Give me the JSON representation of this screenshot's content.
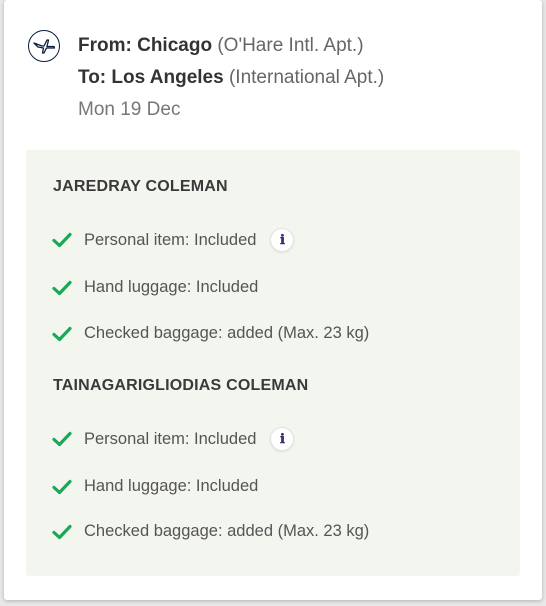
{
  "route": {
    "from_label": "From: Chicago",
    "from_airport": "(O'Hare Intl. Apt.)",
    "to_label": "To: Los Angeles",
    "to_airport": "(International Apt.)",
    "date": "Mon 19 Dec",
    "logo_icon": "crane-logo-icon"
  },
  "colors": {
    "check": "#1aa855",
    "panel_bg": "#f3f5ef"
  },
  "passengers": [
    {
      "name": "JAREDRAY COLEMAN",
      "items": [
        {
          "text": "Personal item: Included",
          "info_icon": "ℹ"
        },
        {
          "text": "Hand luggage: Included"
        },
        {
          "text": "Checked baggage:  added (Max. 23 kg)"
        }
      ]
    },
    {
      "name": "TAINAGARIGLIODIAS COLEMAN",
      "items": [
        {
          "text": "Personal item: Included",
          "info_icon": "ℹ"
        },
        {
          "text": "Hand luggage: Included"
        },
        {
          "text": "Checked baggage:  added (Max. 23 kg)"
        }
      ]
    }
  ]
}
